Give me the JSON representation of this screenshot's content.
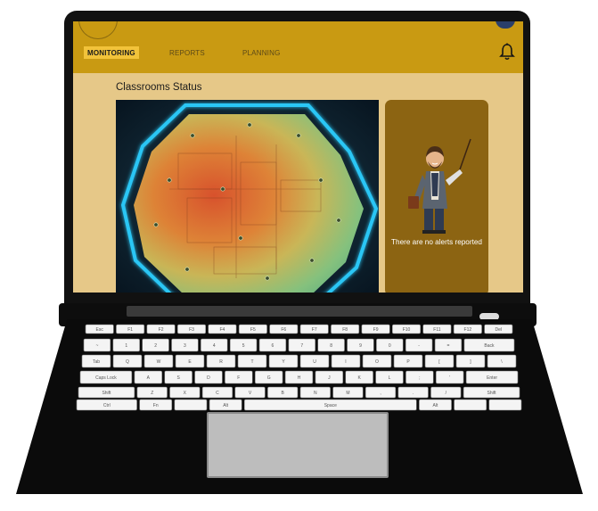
{
  "nav": {
    "tabs": [
      {
        "label": "MONITORING",
        "active": true
      },
      {
        "label": "REPORTS",
        "active": false
      },
      {
        "label": "PLANNING",
        "active": false
      }
    ]
  },
  "icons": {
    "notifications": "bell-icon"
  },
  "main": {
    "title": "Classrooms Status"
  },
  "alerts": {
    "empty_message": "There are no alerts reported"
  },
  "colors": {
    "topbar": "#c99a12",
    "active_tab": "#f2c33a",
    "page_background": "#e6c888",
    "alert_card": "#8c6412",
    "map_border_glow": "#29c6f5"
  },
  "keyboard": {
    "rows": [
      [
        "Esc",
        "F1",
        "F2",
        "F3",
        "F4",
        "F5",
        "F6",
        "F7",
        "F8",
        "F9",
        "F10",
        "F11",
        "F12",
        "Del"
      ],
      [
        "~",
        "1",
        "2",
        "3",
        "4",
        "5",
        "6",
        "7",
        "8",
        "9",
        "0",
        "-",
        "=",
        "Back"
      ],
      [
        "Tab",
        "Q",
        "W",
        "E",
        "R",
        "T",
        "Y",
        "U",
        "I",
        "O",
        "P",
        "[",
        "]",
        "\\"
      ],
      [
        "Caps Lock",
        "A",
        "S",
        "D",
        "F",
        "G",
        "H",
        "J",
        "K",
        "L",
        ";",
        "'",
        "Enter"
      ],
      [
        "Shift",
        "Z",
        "X",
        "C",
        "V",
        "B",
        "N",
        "M",
        ",",
        ".",
        "/",
        "Shift"
      ],
      [
        "Ctrl",
        "Fn",
        "",
        "Alt",
        "Space",
        "Alt",
        "",
        ""
      ]
    ]
  }
}
